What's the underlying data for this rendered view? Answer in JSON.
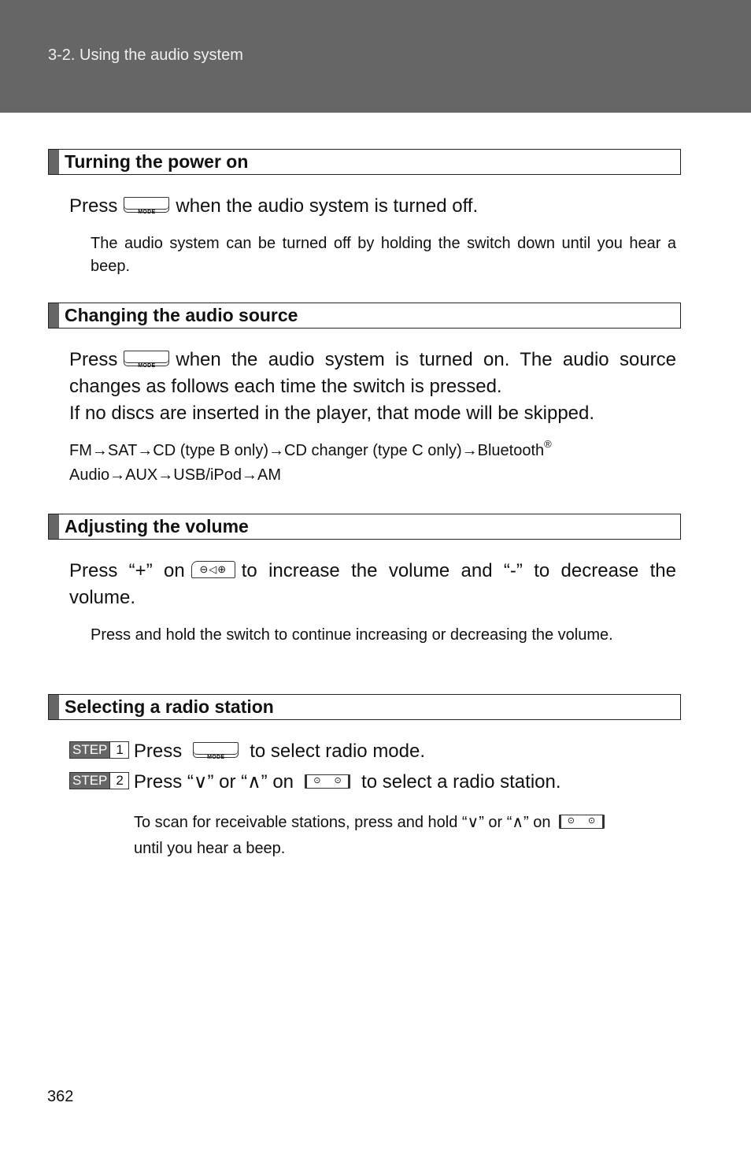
{
  "header": {
    "title": "3-2. Using the audio system"
  },
  "icons": {
    "mode_button": "MODE",
    "volume_switch": "⊖◁⊕",
    "seek_switch": "⊙ ⊙"
  },
  "sections": [
    {
      "title": "Turning the power on",
      "text_before": "Press",
      "text_after": "when the audio system is turned off.",
      "note": "The audio system can be turned off by holding the switch down until you hear a beep."
    },
    {
      "title": "Changing the audio source",
      "text_before": "Press",
      "text_after": "when the audio system is turned on. The audio source changes as follows each time the switch is pressed.",
      "text_extra": "If no discs are inserted in the player, that mode will be skipped.",
      "flow_part1": "FM→SAT→CD (type B only)→CD changer (type C only)→Bluetooth",
      "flow_reg": "®",
      "flow_part2": "Audio→AUX→USB/iPod→AM"
    },
    {
      "title": "Adjusting the volume",
      "text_before": "Press “+” on",
      "text_after": "to increase the volume and “-” to decrease the volume.",
      "note": "Press and hold the switch to continue increasing or decreasing the volume."
    },
    {
      "title": "Selecting a radio station",
      "steps": [
        {
          "label": "STEP",
          "number": "1",
          "text_before": "Press",
          "text_after": "to select radio mode."
        },
        {
          "label": "STEP",
          "number": "2",
          "text_before": "Press “∨” or “∧” on",
          "text_after": "to select a radio station."
        }
      ],
      "note_before": "To scan for receivable stations, press and hold “∨” or “∧” on",
      "note_after": "until you hear a beep."
    }
  ],
  "page_number": "362"
}
